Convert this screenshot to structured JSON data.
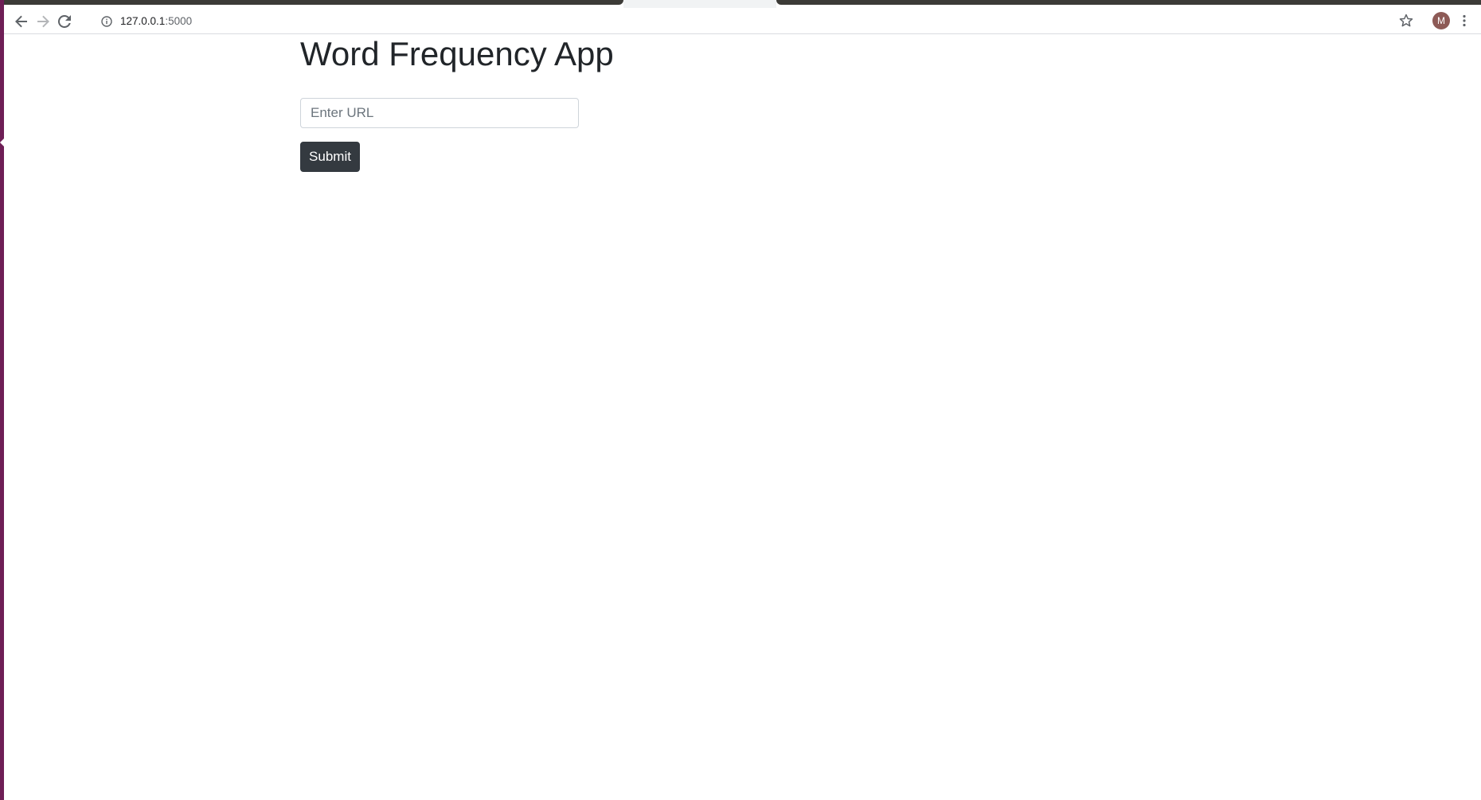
{
  "browser": {
    "url_host": "127.0.0.1",
    "url_port": ":5000",
    "profile_initial": "M",
    "icons": {
      "back": "arrow-left-icon",
      "forward": "arrow-right-icon",
      "reload": "reload-icon",
      "site_info": "info-icon",
      "bookmark": "star-icon",
      "menu": "kebab-menu-icon"
    }
  },
  "page": {
    "title": "Word Frequency App",
    "url_field": {
      "placeholder": "Enter URL",
      "value": ""
    },
    "submit_label": "Submit"
  },
  "colors": {
    "button_bg": "#343a40",
    "title_text": "#212529",
    "desktop_edge": "#6e1e56",
    "avatar_bg": "#8d5a56"
  }
}
